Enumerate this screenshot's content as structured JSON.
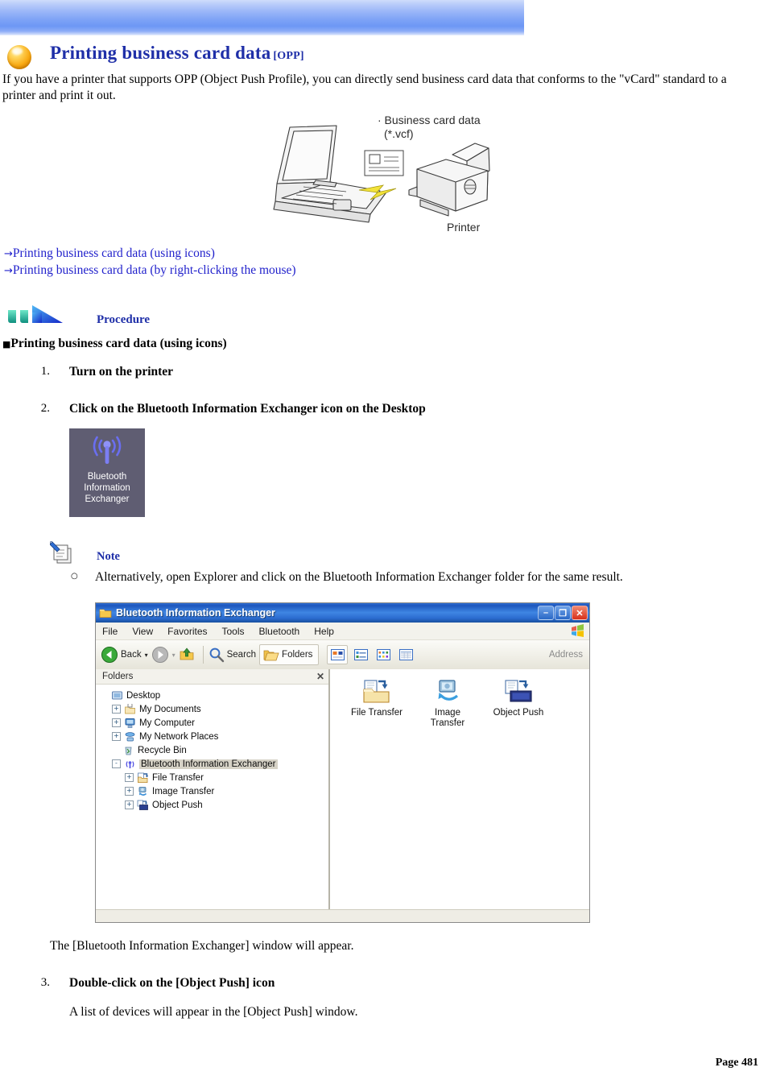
{
  "banner": {
    "name": "top-decorative-banner"
  },
  "header": {
    "bullet_icon": "orange-sphere-icon",
    "title": "Printing business card data",
    "title_tag": "[OPP]"
  },
  "intro": "If you have a printer that supports OPP (Object Push Profile), you can directly send business card data that conforms to the \"vCard\" standard to a printer and print it out.",
  "diagram": {
    "caption_line1": "· Business card data",
    "caption_line2": "(*.vcf)",
    "printer_label": "Printer"
  },
  "links": [
    {
      "arrow": "→",
      "label": "Printing business card data (using icons)"
    },
    {
      "arrow": "→",
      "label": "Printing business card data (by right-clicking the mouse)"
    }
  ],
  "procedure": {
    "icon": "blue-arrow-icon",
    "label": "Procedure",
    "section_bullet": "■",
    "section_heading": "Printing business card data (using icons)"
  },
  "steps": [
    {
      "num": "1.",
      "text": "Turn on the printer"
    },
    {
      "num": "2.",
      "text": "Click on the Bluetooth Information Exchanger icon on the Desktop"
    },
    {
      "num": "3.",
      "text": "Double-click on the [Object Push] icon"
    }
  ],
  "desktop_icon": {
    "icon": "bluetooth-information-exchanger-icon",
    "label": "Bluetooth\nInformation\nExchanger"
  },
  "note": {
    "icon": "note-pencil-icon",
    "label": "Note",
    "bullet": "○",
    "text": "Alternatively, open Explorer and click on the Bluetooth Information Exchanger folder for the same result."
  },
  "explorer": {
    "title": "Bluetooth Information Exchanger",
    "window_buttons": {
      "minimize": "–",
      "maximize": "❐",
      "close": "✕"
    },
    "menus": [
      "File",
      "View",
      "Favorites",
      "Tools",
      "Bluetooth",
      "Help"
    ],
    "toolbar": {
      "back": "Back",
      "search": "Search",
      "folders": "Folders",
      "address": "Address"
    },
    "folders_pane": {
      "header": "Folders",
      "close": "✕",
      "tree": [
        {
          "label": "Desktop",
          "indent": 0,
          "expander": "none",
          "icon": "desktop-icon",
          "selected": false
        },
        {
          "label": "My Documents",
          "indent": 1,
          "expander": "+",
          "icon": "my-documents-icon",
          "selected": false
        },
        {
          "label": "My Computer",
          "indent": 1,
          "expander": "+",
          "icon": "my-computer-icon",
          "selected": false
        },
        {
          "label": "My Network Places",
          "indent": 1,
          "expander": "+",
          "icon": "network-places-icon",
          "selected": false
        },
        {
          "label": "Recycle Bin",
          "indent": 1,
          "expander": "none",
          "icon": "recycle-bin-icon",
          "selected": false
        },
        {
          "label": "Bluetooth Information Exchanger",
          "indent": 1,
          "expander": "-",
          "icon": "bluetooth-icon",
          "selected": true
        },
        {
          "label": "File Transfer",
          "indent": 2,
          "expander": "+",
          "icon": "file-transfer-icon",
          "selected": false
        },
        {
          "label": "Image Transfer",
          "indent": 2,
          "expander": "+",
          "icon": "image-transfer-icon",
          "selected": false
        },
        {
          "label": "Object Push",
          "indent": 2,
          "expander": "+",
          "icon": "object-push-icon",
          "selected": false
        }
      ]
    },
    "content_items": [
      {
        "label": "File Transfer",
        "icon": "file-transfer-icon"
      },
      {
        "label": "Image\nTransfer",
        "icon": "image-transfer-icon"
      },
      {
        "label": "Object Push",
        "icon": "object-push-icon"
      }
    ]
  },
  "after_window_text": "The [Bluetooth Information Exchanger] window will appear.",
  "step3_detail": "A list of devices will appear in the [Object Push] window.",
  "footer": {
    "page_number": "Page 481"
  }
}
